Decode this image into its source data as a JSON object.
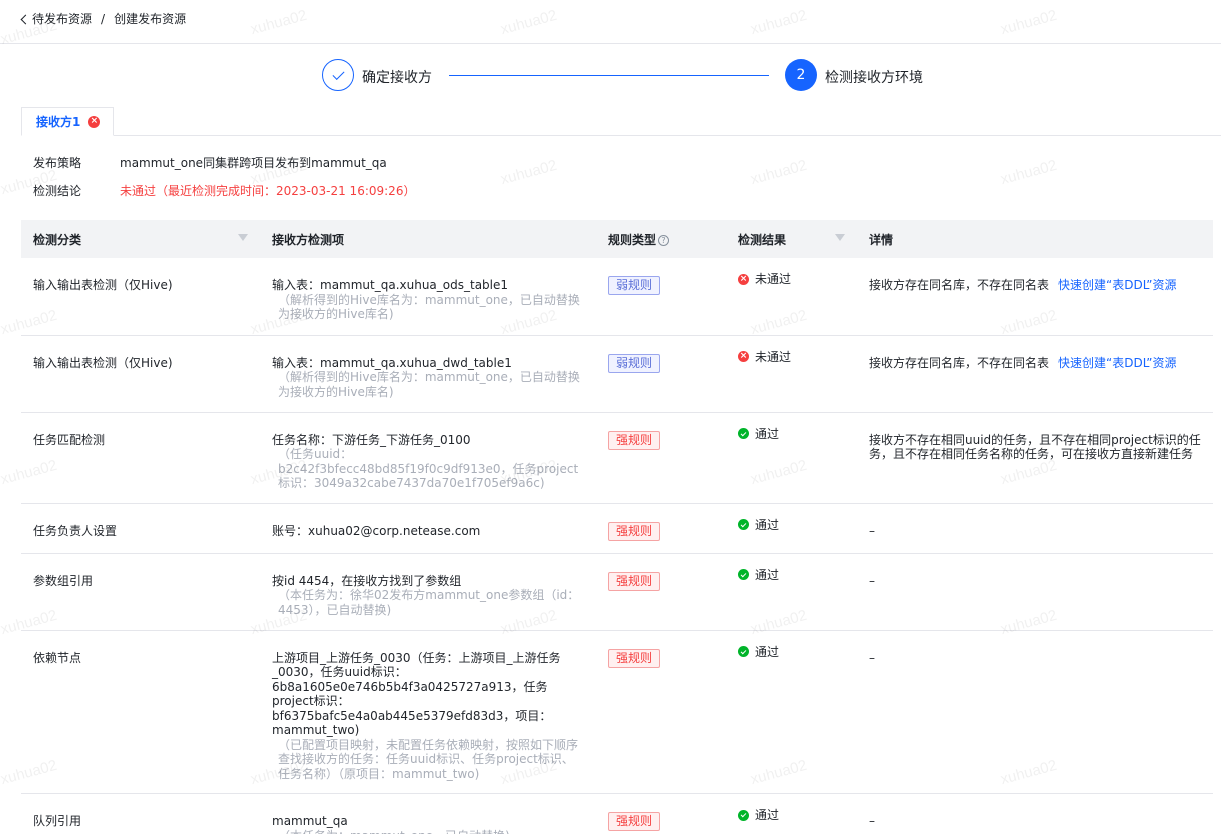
{
  "breadcrumb": {
    "back": "待发布资源",
    "separator": "/",
    "current": "创建发布资源"
  },
  "steps": [
    {
      "label": "确定接收方",
      "state": "done"
    },
    {
      "number": "2",
      "label": "检测接收方环境",
      "state": "active"
    }
  ],
  "tabs": [
    {
      "label": "接收方1"
    }
  ],
  "info": {
    "strategy_label": "发布策略",
    "strategy_value": "mammut_one同集群跨项目发布到mammut_qa",
    "result_label": "检测结论",
    "result_value": "未通过（最近检测完成时间：2023-03-21 16:09:26）"
  },
  "table": {
    "headers": {
      "category": "检测分类",
      "item": "接收方检测项",
      "rule": "规则类型",
      "result": "检测结果",
      "detail": "详情"
    },
    "rows": [
      {
        "category": "输入输出表检测（仅Hive)",
        "item": "输入表：mammut_qa.xuhua_ods_table1",
        "item_sub": "（解析得到的Hive库名为：mammut_one，已自动替换为接收方的Hive库名)",
        "rule": "弱规则",
        "result": "未通过",
        "detail": "接收方存在同名库，不存在同名表",
        "link": "快速创建“表DDL”资源"
      },
      {
        "category": "输入输出表检测（仅Hive)",
        "item": "输入表：mammut_qa.xuhua_dwd_table1",
        "item_sub": "（解析得到的Hive库名为：mammut_one，已自动替换为接收方的Hive库名)",
        "rule": "弱规则",
        "result": "未通过",
        "detail": "接收方存在同名库，不存在同名表",
        "link": "快速创建“表DDL”资源"
      },
      {
        "category": "任务匹配检测",
        "item": "任务名称：下游任务_下游任务_0100",
        "item_sub": "（任务uuid：b2c42f3bfecc48bd85f19f0c9df913e0，任务project标识：3049a32cabe7437da70e1f705ef9a6c)",
        "rule": "强规则",
        "result": "通过",
        "detail": "接收方不存在相同uuid的任务，且不存在相同project标识的任务，且不存在相同任务名称的任务，可在接收方直接新建任务",
        "link": ""
      },
      {
        "category": "任务负责人设置",
        "item": "账号：xuhua02@corp.netease.com",
        "item_sub": "",
        "rule": "强规则",
        "result": "通过",
        "detail": "–",
        "link": ""
      },
      {
        "category": "参数组引用",
        "item": "按id 4454，在接收方找到了参数组",
        "item_sub": "（本任务为：徐华02发布方mammut_one参数组（id：4453），已自动替换)",
        "rule": "强规则",
        "result": "通过",
        "detail": "–",
        "link": ""
      },
      {
        "category": "依赖节点",
        "item": "上游项目_上游任务_0030（任务：上游项目_上游任务_0030，任务uuid标识：6b8a1605e0e746b5b4f3a0425727a913，任务project标识：bf6375bafc5e4a0ab445e5379efd83d3，项目：mammut_two)",
        "item_sub": "（已配置项目映射，未配置任务依赖映射，按照如下顺序查找接收方的任务：任务uuid标识、任务project标识、任务名称）（原项目：mammut_two)",
        "rule": "强规则",
        "result": "通过",
        "detail": "–",
        "link": ""
      },
      {
        "category": "队列引用",
        "item": "mammut_qa",
        "item_sub": "（本任务为：mammut_one，已自动替换)",
        "rule": "强规则",
        "result": "通过",
        "detail": "–",
        "link": ""
      }
    ]
  },
  "watermark": "xuhua02",
  "colors": {
    "primary": "#1664ff",
    "error": "#f53f3f",
    "success": "#00b42a"
  }
}
